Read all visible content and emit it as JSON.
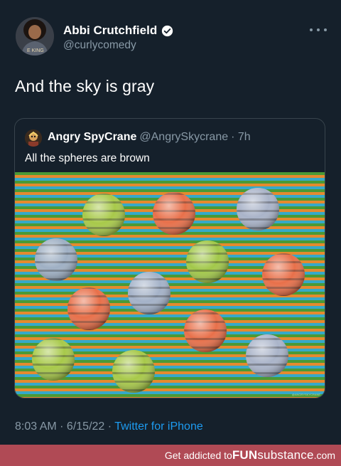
{
  "tweet": {
    "author_name": "Abbi Crutchfield",
    "author_handle": "@curlycomedy",
    "avatar_shirt_text": "E KING",
    "text": "And the sky is gray",
    "timestamp": "8:03 AM · 6/15/22 · ",
    "source": "Twitter for iPhone"
  },
  "quote": {
    "author_name": "Angry SpyCrane",
    "author_handle": "@AngrySkycrane",
    "time": "· 7h",
    "text": "All the spheres are brown",
    "image_watermark": "@ANGRYSKYCRANE"
  },
  "banner": {
    "prefix": "Get addicted to ",
    "brand_main": "FUN",
    "brand_sub": "substance",
    "domain": ".com"
  },
  "colors": {
    "background": "#15202b",
    "secondary_text": "#8899a6",
    "link": "#1d9bf0",
    "banner": "#b04a55",
    "stripe_green": "#4a9a36",
    "stripe_orange": "#e58a2e",
    "stripe_blue": "#36a9c9"
  }
}
